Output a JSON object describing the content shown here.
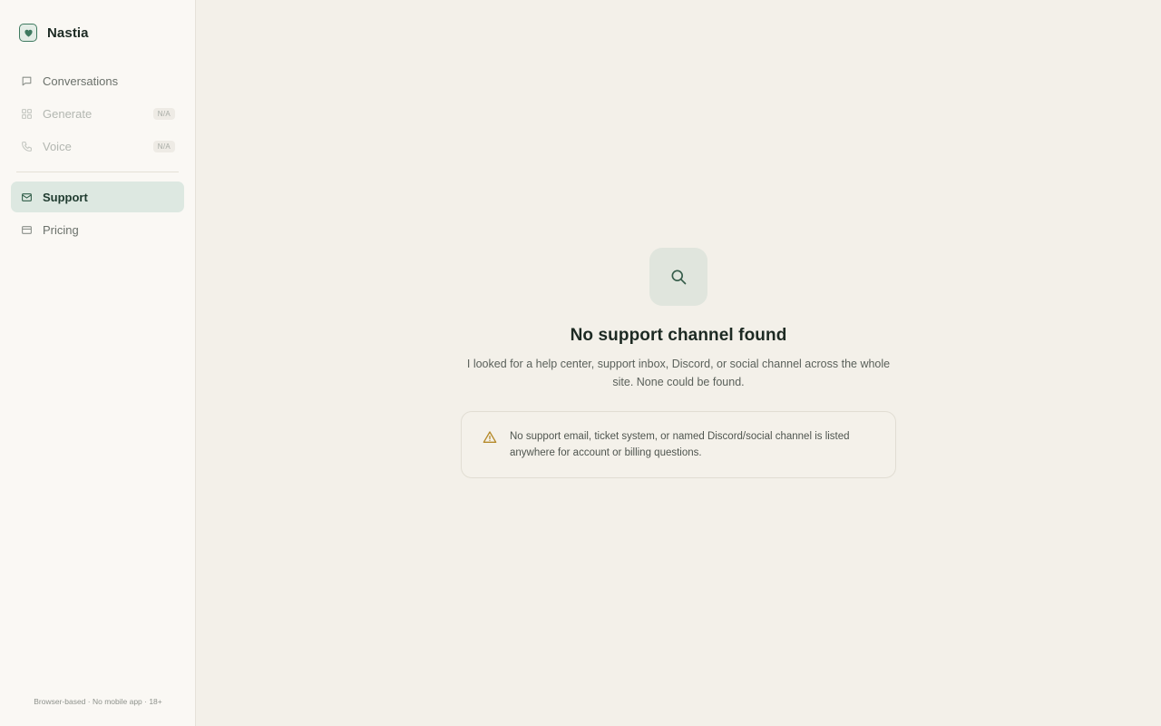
{
  "app": {
    "name": "Nastia"
  },
  "sidebar": {
    "items": [
      {
        "label": "Conversations",
        "icon": "chat-bubble-icon",
        "disabled": false,
        "active": false,
        "badge": ""
      },
      {
        "label": "Generate",
        "icon": "grid-icon",
        "disabled": true,
        "active": false,
        "badge": "N/A"
      },
      {
        "label": "Voice",
        "icon": "phone-icon",
        "disabled": true,
        "active": false,
        "badge": "N/A"
      },
      {
        "label": "Support",
        "icon": "mail-icon",
        "disabled": false,
        "active": true,
        "badge": ""
      },
      {
        "label": "Pricing",
        "icon": "credit-card-icon",
        "disabled": false,
        "active": false,
        "badge": ""
      }
    ],
    "footer": "Browser-based · No mobile app · 18+"
  },
  "main": {
    "icon": "search-icon",
    "title": "No support channel found",
    "description": "I looked for a help center, support inbox, Discord, or social channel across the whole site. None could be found.",
    "notice": {
      "icon": "warning-icon",
      "text": "No support email, ticket system, or named Discord/social channel is listed anywhere for account or billing questions."
    }
  },
  "colors": {
    "accent": "#3f7a60",
    "active_bg": "#dde8e1",
    "page_bg": "#f3f0e9",
    "sidebar_bg": "#faf8f4",
    "warning": "#b58a2a"
  }
}
